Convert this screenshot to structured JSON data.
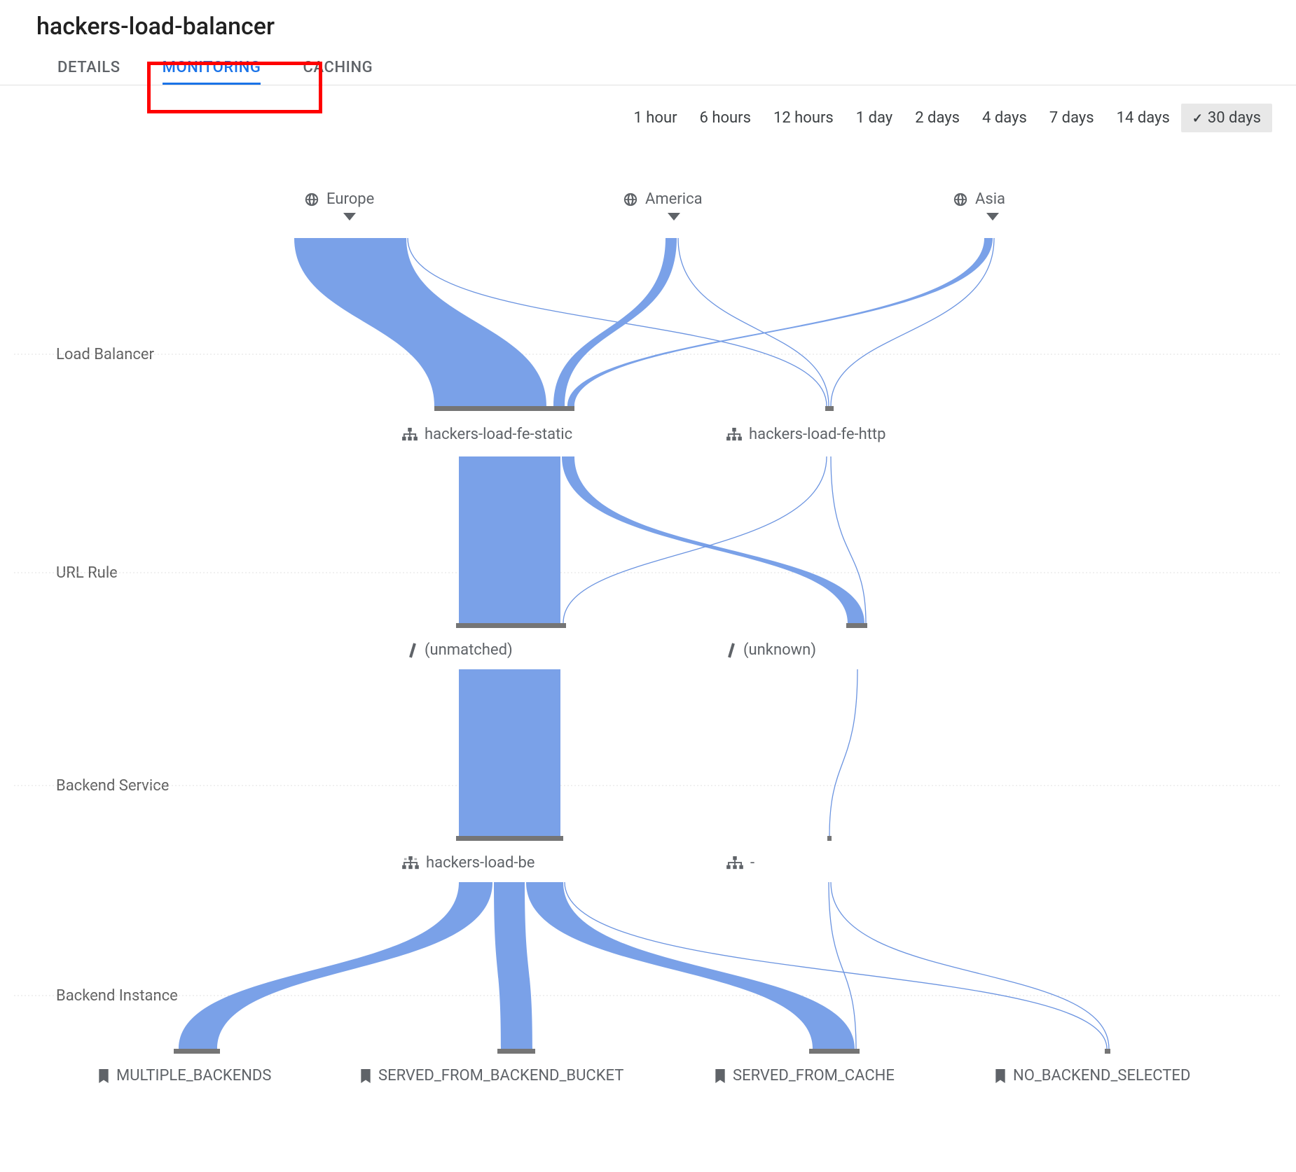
{
  "title": "hackers-load-balancer",
  "tabs": [
    {
      "id": "details",
      "label": "DETAILS",
      "active": false
    },
    {
      "id": "monitoring",
      "label": "MONITORING",
      "active": true
    },
    {
      "id": "caching",
      "label": "CACHING",
      "active": false
    }
  ],
  "highlight": {
    "target": "monitoring"
  },
  "time_ranges": {
    "options": [
      "1 hour",
      "6 hours",
      "12 hours",
      "1 day",
      "2 days",
      "4 days",
      "7 days",
      "14 days",
      "30 days"
    ],
    "selected": "30 days"
  },
  "colors": {
    "ribbon": "#7aa1e8",
    "ribbon_stroke": "#6a93e0",
    "bar": "#757575",
    "tab_active": "#1a73e8"
  },
  "flow": {
    "tiers": [
      {
        "id": "source",
        "label": "",
        "nodes": [
          {
            "id": "europe",
            "label": "Europe",
            "icon": "globe-icon",
            "dropdown": true
          },
          {
            "id": "america",
            "label": "America",
            "icon": "globe-icon",
            "dropdown": true
          },
          {
            "id": "asia",
            "label": "Asia",
            "icon": "globe-icon",
            "dropdown": true
          }
        ]
      },
      {
        "id": "load-balancer",
        "label": "Load Balancer",
        "nodes": [
          {
            "id": "fe-static",
            "label": "hackers-load-fe-static",
            "icon": "network-icon"
          },
          {
            "id": "fe-http",
            "label": "hackers-load-fe-http",
            "icon": "network-icon"
          }
        ]
      },
      {
        "id": "url-rule",
        "label": "URL Rule",
        "nodes": [
          {
            "id": "unmatched",
            "label": "(unmatched)",
            "icon": "slash-icon"
          },
          {
            "id": "unknown",
            "label": "(unknown)",
            "icon": "slash-icon"
          }
        ]
      },
      {
        "id": "backend-service",
        "label": "Backend Service",
        "nodes": [
          {
            "id": "be",
            "label": "hackers-load-be",
            "icon": "network-group-icon"
          },
          {
            "id": "be-none",
            "label": "-",
            "icon": "network-group-icon"
          }
        ]
      },
      {
        "id": "backend-instance",
        "label": "Backend Instance",
        "nodes": [
          {
            "id": "multi",
            "label": "MULTIPLE_BACKENDS",
            "icon": "bookmark-icon"
          },
          {
            "id": "bucket",
            "label": "SERVED_FROM_BACKEND_BUCKET",
            "icon": "bookmark-icon"
          },
          {
            "id": "cache",
            "label": "SERVED_FROM_CACHE",
            "icon": "bookmark-icon"
          },
          {
            "id": "none",
            "label": "NO_BACKEND_SELECTED",
            "icon": "bookmark-icon"
          }
        ]
      }
    ]
  },
  "chart_data": {
    "type": "sankey",
    "title": "",
    "tiers": [
      "source",
      "load-balancer",
      "url-rule",
      "backend-service",
      "backend-instance"
    ],
    "links": [
      {
        "from": "europe",
        "to": "fe-static",
        "value": 120
      },
      {
        "from": "europe",
        "to": "fe-http",
        "value": 2
      },
      {
        "from": "america",
        "to": "fe-static",
        "value": 14
      },
      {
        "from": "america",
        "to": "fe-http",
        "value": 1
      },
      {
        "from": "asia",
        "to": "fe-static",
        "value": 10
      },
      {
        "from": "asia",
        "to": "fe-http",
        "value": 1
      },
      {
        "from": "fe-static",
        "to": "unmatched",
        "value": 125
      },
      {
        "from": "fe-static",
        "to": "unknown",
        "value": 20
      },
      {
        "from": "fe-http",
        "to": "unmatched",
        "value": 2
      },
      {
        "from": "fe-http",
        "to": "unknown",
        "value": 2
      },
      {
        "from": "unmatched",
        "to": "be",
        "value": 127
      },
      {
        "from": "unknown",
        "to": "be-none",
        "value": 2
      },
      {
        "from": "be",
        "to": "multi",
        "value": 40
      },
      {
        "from": "be",
        "to": "bucket",
        "value": 38
      },
      {
        "from": "be",
        "to": "cache",
        "value": 47
      },
      {
        "from": "be",
        "to": "none",
        "value": 2
      },
      {
        "from": "be-none",
        "to": "cache",
        "value": 1
      },
      {
        "from": "be-none",
        "to": "none",
        "value": 1
      }
    ]
  }
}
